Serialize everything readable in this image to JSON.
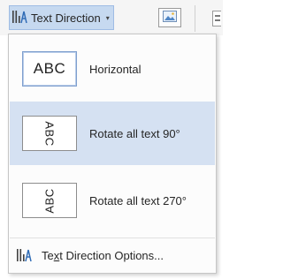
{
  "ribbon": {
    "button_label": "Text Direction",
    "caret": "▾"
  },
  "menu": {
    "items": [
      {
        "label": "Horizontal",
        "preview": "ABC",
        "selected": true
      },
      {
        "label": "Rotate all text 90°",
        "preview": "ABC",
        "highlighted": true
      },
      {
        "label": "Rotate all text 270°",
        "preview": "ABC"
      }
    ],
    "options": {
      "label_before": "Te",
      "label_access": "x",
      "label_after": "t Direction Options..."
    }
  },
  "colors": {
    "highlight": "#d5e1f2",
    "ribbon_button": "#c6d9f0",
    "icon_blue": "#2f6bb5"
  },
  "icons": [
    "text-direction-icon",
    "picture-icon",
    "align-icon",
    "dropdown-caret-icon"
  ]
}
